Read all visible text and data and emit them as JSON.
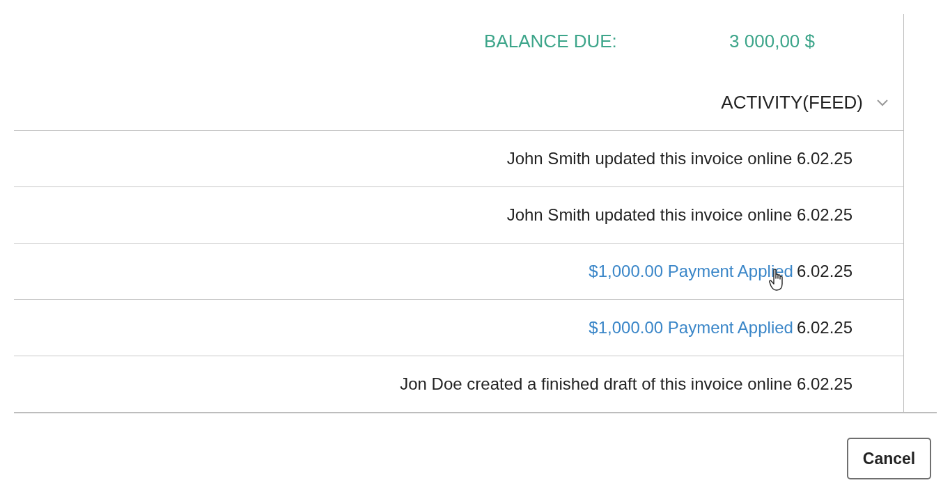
{
  "balance": {
    "label": "BALANCE DUE:",
    "value": "3 000,00 $"
  },
  "activity": {
    "title": "ACTIVITY(FEED)",
    "expanded": true,
    "items": [
      {
        "kind": "text",
        "text": "John Smith updated this invoice online 6.02.25"
      },
      {
        "kind": "text",
        "text": "John Smith updated this invoice online 6.02.25"
      },
      {
        "kind": "link",
        "link": "$1,000.00 Payment Applied",
        "text": "6.02.25"
      },
      {
        "kind": "link",
        "link": "$1,000.00 Payment Applied",
        "text": "6.02.25"
      },
      {
        "kind": "text",
        "text": "Jon Doe created a finished draft of this invoice online 6.02.25"
      }
    ]
  },
  "buttons": [
    "Cancel"
  ]
}
